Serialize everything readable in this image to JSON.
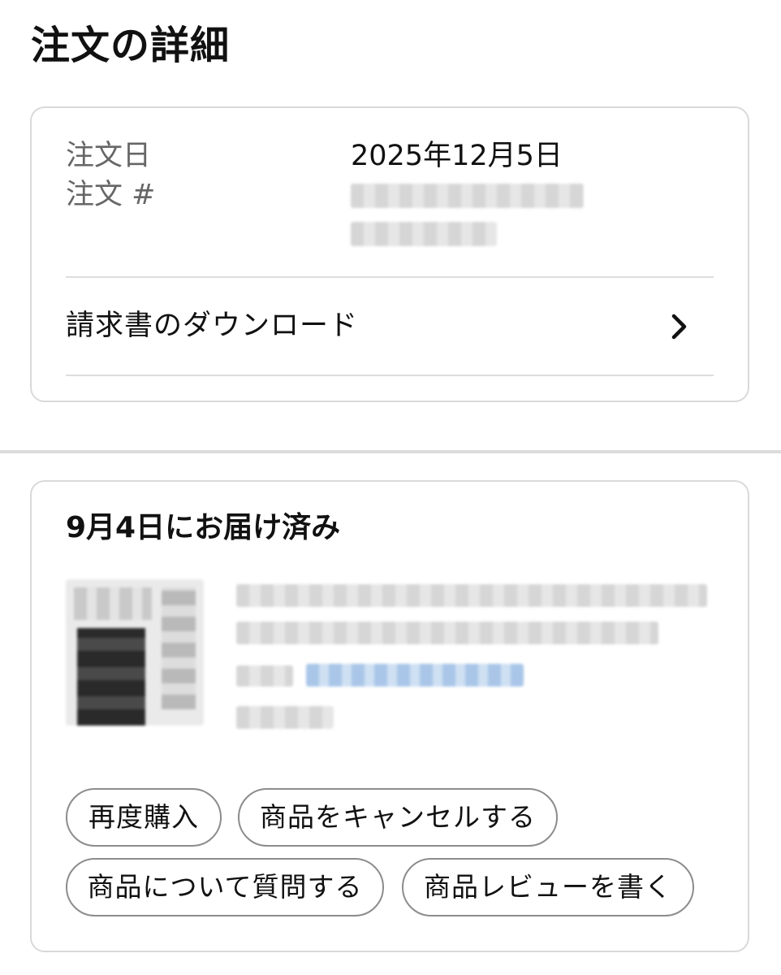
{
  "page": {
    "title": "注文の詳細"
  },
  "order": {
    "date_label": "注文日",
    "date_value": "2025年12月5日",
    "number_label": "注文 #",
    "invoice_label": "請求書のダウンロード"
  },
  "delivery": {
    "title": "9月4日にお届け済み"
  },
  "actions": {
    "rebuy": "再度購入",
    "cancel": "商品をキャンセルする",
    "question": "商品について質問する",
    "review": "商品レビューを書く"
  },
  "icons": {
    "invoice_chevron": "chevron-right-icon"
  }
}
